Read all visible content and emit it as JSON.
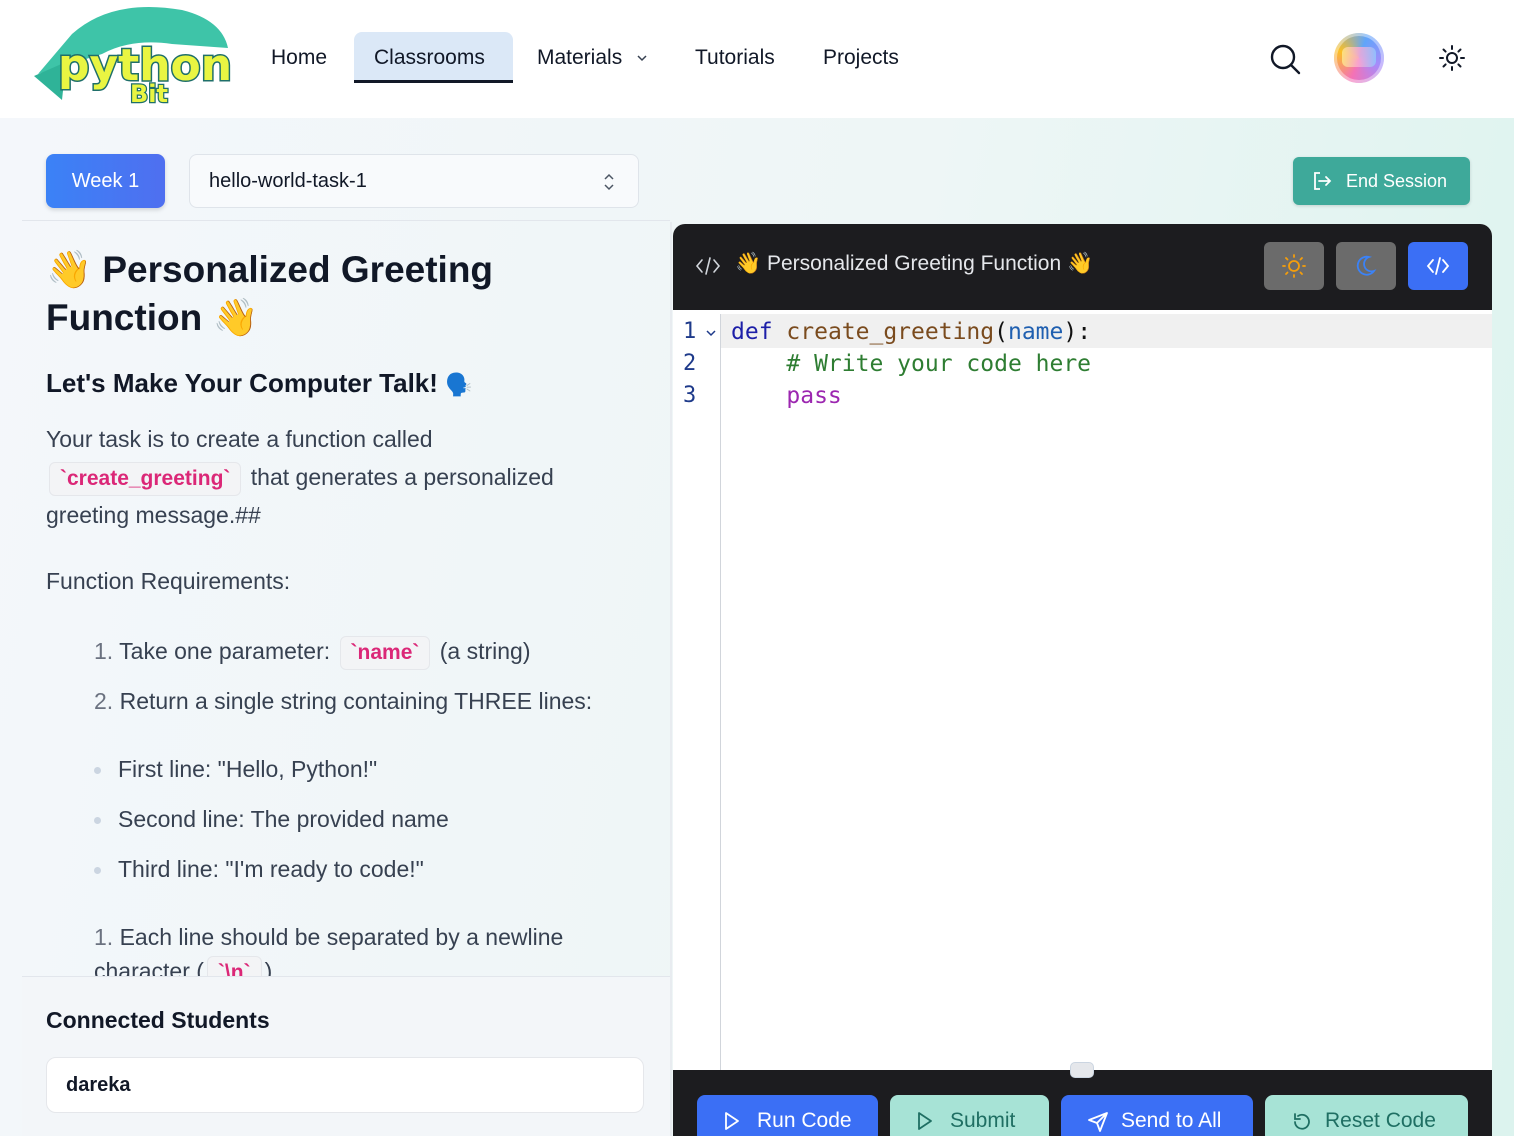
{
  "brand": {
    "logo_text": "python",
    "logo_subtext": "Bit"
  },
  "nav": {
    "items": [
      {
        "label": "Home"
      },
      {
        "label": "Classrooms",
        "active": true
      },
      {
        "label": "Materials",
        "has_dropdown": true
      },
      {
        "label": "Tutorials"
      },
      {
        "label": "Projects"
      }
    ]
  },
  "toolbar": {
    "week_label": "Week 1",
    "task_selected": "hello-world-task-1",
    "end_session_label": "End Session"
  },
  "task": {
    "title_emoji": "👋",
    "title": "Personalized Greeting Function",
    "subtitle": "Let's Make Your Computer Talk!",
    "subtitle_emoji": "🗣️",
    "intro_before": "Your task is to create a function called",
    "intro_code": "`create_greeting`",
    "intro_after": "that generates a personalized greeting message.##",
    "requirements_heading": "Function Requirements:",
    "req1_num": "1.",
    "req1_text": "Take one parameter:",
    "req1_code": "`name`",
    "req1_after": "(a string)",
    "req2_num": "2.",
    "req2_text": "Return a single string containing THREE lines:",
    "bullets": [
      "First line: \"Hello, Python!\"",
      "Second line: The provided name",
      "Third line: \"I'm ready to code!\""
    ],
    "req3_num": "1.",
    "req3_text": "Each line should be separated by a newline",
    "req3_cont": "character (",
    "req3_code": "`\\n`",
    "req3_close": ")"
  },
  "students": {
    "heading": "Connected Students",
    "list": [
      "dareka"
    ]
  },
  "editor": {
    "title": "👋 Personalized Greeting Function 👋",
    "line_numbers": [
      "1",
      "2",
      "3"
    ],
    "code": {
      "l1_kw": "def",
      "l1_fn": "create_greeting",
      "l1_open": "(",
      "l1_param": "name",
      "l1_close": "):",
      "l2": "    # Write your code here",
      "l3": "    pass"
    },
    "buttons": {
      "run": "Run Code",
      "submit": "Submit",
      "send_all": "Send to All",
      "reset": "Reset Code"
    }
  },
  "colors": {
    "primary_blue": "#3b82f6",
    "teal": "#3ea99a",
    "editor_dark": "#1c1c1f",
    "code_pink": "#db2777"
  }
}
